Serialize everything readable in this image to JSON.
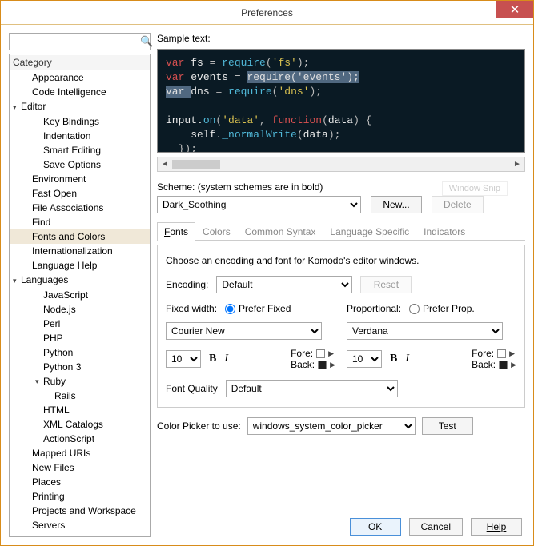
{
  "window": {
    "title": "Preferences"
  },
  "sidebar": {
    "header": "Category",
    "items": [
      {
        "label": "Appearance",
        "depth": 1,
        "twisty": ""
      },
      {
        "label": "Code Intelligence",
        "depth": 1,
        "twisty": ""
      },
      {
        "label": "Editor",
        "depth": 0,
        "twisty": "▾"
      },
      {
        "label": "Key Bindings",
        "depth": 2,
        "twisty": ""
      },
      {
        "label": "Indentation",
        "depth": 2,
        "twisty": ""
      },
      {
        "label": "Smart Editing",
        "depth": 2,
        "twisty": ""
      },
      {
        "label": "Save Options",
        "depth": 2,
        "twisty": ""
      },
      {
        "label": "Environment",
        "depth": 1,
        "twisty": ""
      },
      {
        "label": "Fast Open",
        "depth": 1,
        "twisty": ""
      },
      {
        "label": "File Associations",
        "depth": 1,
        "twisty": ""
      },
      {
        "label": "Find",
        "depth": 1,
        "twisty": ""
      },
      {
        "label": "Fonts and Colors",
        "depth": 1,
        "twisty": "",
        "selected": true
      },
      {
        "label": "Internationalization",
        "depth": 1,
        "twisty": ""
      },
      {
        "label": "Language Help",
        "depth": 1,
        "twisty": ""
      },
      {
        "label": "Languages",
        "depth": 0,
        "twisty": "▾"
      },
      {
        "label": "JavaScript",
        "depth": 2,
        "twisty": ""
      },
      {
        "label": "Node.js",
        "depth": 2,
        "twisty": ""
      },
      {
        "label": "Perl",
        "depth": 2,
        "twisty": ""
      },
      {
        "label": "PHP",
        "depth": 2,
        "twisty": ""
      },
      {
        "label": "Python",
        "depth": 2,
        "twisty": ""
      },
      {
        "label": "Python 3",
        "depth": 2,
        "twisty": ""
      },
      {
        "label": "Ruby",
        "depth": 2,
        "twisty": "▾"
      },
      {
        "label": "Rails",
        "depth": 3,
        "twisty": ""
      },
      {
        "label": "HTML",
        "depth": 2,
        "twisty": ""
      },
      {
        "label": "XML Catalogs",
        "depth": 2,
        "twisty": ""
      },
      {
        "label": "ActionScript",
        "depth": 2,
        "twisty": ""
      },
      {
        "label": "Mapped URIs",
        "depth": 1,
        "twisty": ""
      },
      {
        "label": "New Files",
        "depth": 1,
        "twisty": ""
      },
      {
        "label": "Places",
        "depth": 1,
        "twisty": ""
      },
      {
        "label": "Printing",
        "depth": 1,
        "twisty": ""
      },
      {
        "label": "Projects and Workspace",
        "depth": 1,
        "twisty": ""
      },
      {
        "label": "Servers",
        "depth": 1,
        "twisty": ""
      }
    ]
  },
  "sample": {
    "label": "Sample text:",
    "lines": [
      [
        {
          "t": "var ",
          "c": "kw"
        },
        {
          "t": "fs ",
          "c": "id"
        },
        {
          "t": "= ",
          "c": "pn"
        },
        {
          "t": "require",
          "c": "fn"
        },
        {
          "t": "(",
          "c": "pn"
        },
        {
          "t": "'fs'",
          "c": "str"
        },
        {
          "t": ");",
          "c": "pn"
        }
      ],
      [
        {
          "t": "var ",
          "c": "kw"
        },
        {
          "t": "events ",
          "c": "id"
        },
        {
          "t": "= ",
          "c": "pn"
        },
        {
          "t": "require('events');",
          "c": "hl"
        }
      ],
      [
        {
          "t": "var ",
          "c": "hl"
        },
        {
          "t": "dns ",
          "c": "id"
        },
        {
          "t": "= ",
          "c": "pn"
        },
        {
          "t": "require",
          "c": "fn"
        },
        {
          "t": "(",
          "c": "pn"
        },
        {
          "t": "'dns'",
          "c": "str"
        },
        {
          "t": ");",
          "c": "pn"
        }
      ],
      [],
      [
        {
          "t": "input.",
          "c": "id"
        },
        {
          "t": "on",
          "c": "fn"
        },
        {
          "t": "(",
          "c": "pn"
        },
        {
          "t": "'data'",
          "c": "str"
        },
        {
          "t": ", ",
          "c": "pn"
        },
        {
          "t": "function",
          "c": "kw"
        },
        {
          "t": "(",
          "c": "pn"
        },
        {
          "t": "data",
          "c": "id"
        },
        {
          "t": ") {",
          "c": "pn"
        }
      ],
      [
        {
          "t": "    self.",
          "c": "id"
        },
        {
          "t": "_normalWrite",
          "c": "fn"
        },
        {
          "t": "(",
          "c": "pn"
        },
        {
          "t": "data",
          "c": "id"
        },
        {
          "t": ");",
          "c": "pn"
        }
      ],
      [
        {
          "t": "  });",
          "c": "pn"
        }
      ]
    ]
  },
  "scheme": {
    "label": "Scheme: (system schemes are in bold)",
    "value": "Dark_Soothing",
    "new_btn": "New...",
    "delete_btn": "Delete",
    "ghost": "Window Snip"
  },
  "tabs": [
    "Fonts",
    "Colors",
    "Common Syntax",
    "Language Specific",
    "Indicators"
  ],
  "fonts_panel": {
    "desc": "Choose an encoding and font for Komodo's editor windows.",
    "encoding_label": "Encoding:",
    "encoding_value": "Default",
    "reset_btn": "Reset",
    "fixed_label": "Fixed width:",
    "fixed_radio": "Prefer Fixed",
    "prop_label": "Proportional:",
    "prop_radio": "Prefer Prop.",
    "fixed_font": "Courier New",
    "prop_font": "Verdana",
    "size_left": "10",
    "size_right": "10",
    "fore_label": "Fore:",
    "back_label": "Back:",
    "quality_label": "Font Quality",
    "quality_value": "Default"
  },
  "color_picker": {
    "label": "Color Picker to use:",
    "value": "windows_system_color_picker",
    "test_btn": "Test"
  },
  "buttons": {
    "ok": "OK",
    "cancel": "Cancel",
    "help": "Help"
  }
}
